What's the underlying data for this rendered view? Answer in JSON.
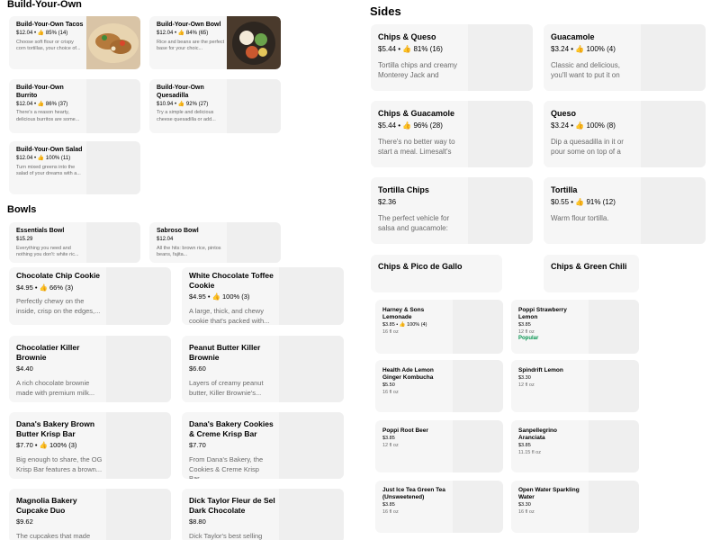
{
  "sections": {
    "build": "Build-Your-Own",
    "sides": "Sides",
    "bowls": "Bowls"
  },
  "build_items": [
    {
      "name": "Build-Your-Own Tacos",
      "meta": "$12.04 • 👍 85% (14)",
      "desc": "Choose soft flour or crispy corn tortillas, your choice of..."
    },
    {
      "name": "Build-Your-Own Bowl",
      "meta": "$12.04 • 👍 84% (65)",
      "desc": "Rice and beans are the perfect base for your choic..."
    },
    {
      "name": "Build-Your-Own Burrito",
      "meta": "$12.04 • 👍 86% (37)",
      "desc": "There's a reason hearty, delicious burritos are some..."
    },
    {
      "name": "Build-Your-Own Quesadilla",
      "meta": "$10.94 • 👍 92% (27)",
      "desc": "Try a simple and delicious cheese quesadilla or add..."
    },
    {
      "name": "Build-Your-Own Salad",
      "meta": "$12.04 • 👍 100% (11)",
      "desc": "Turn mixed greens into the salad of your dreams with a..."
    }
  ],
  "bowl_items": [
    {
      "name": "Essentials Bowl",
      "meta": "$15.29",
      "desc": "Everything you need and nothing you don't: white ric..."
    },
    {
      "name": "Sabroso Bowl",
      "meta": "$12.04",
      "desc": "All the hits: brown rice, pintos beans, fajita..."
    }
  ],
  "dessert_items": [
    {
      "name": "Chocolate Chip Cookie",
      "meta": "$4.95 • 👍 66% (3)",
      "desc": "Perfectly chewy on the inside, crisp on the edges,..."
    },
    {
      "name": "White Chocolate Toffee Cookie",
      "meta": "$4.95 • 👍 100% (3)",
      "desc": "A large, thick, and chewy cookie that's packed with..."
    },
    {
      "name": "Chocolatier Killer Brownie",
      "meta": "$4.40",
      "desc": "A rich chocolate brownie made with premium milk..."
    },
    {
      "name": "Peanut Butter Killer Brownie",
      "meta": "$6.60",
      "desc": "Layers of creamy peanut butter, Killer Brownie's..."
    },
    {
      "name": "Dana's Bakery Brown Butter Krisp Bar",
      "meta": "$7.70 • 👍 100% (3)",
      "desc": "Big enough to share, the OG Krisp Bar features a brown..."
    },
    {
      "name": "Dana's Bakery Cookies & Creme Krisp Bar",
      "meta": "$7.70",
      "desc": "From Dana's Bakery, the Cookies & Creme Krisp Bar..."
    },
    {
      "name": "Magnolia Bakery Cupcake Duo",
      "meta": "$9.62",
      "desc": "The cupcakes that made Magnolia Bakery famous..."
    },
    {
      "name": "Dick Taylor Fleur de Sel Dark Chocolate",
      "meta": "$8.80",
      "desc": "Dick Taylor's best selling Fleur de Sel chocolate is a..."
    }
  ],
  "side_items": [
    {
      "name": "Chips & Queso",
      "meta": "$5.44 • 👍 81% (16)",
      "desc": "Tortilla chips and creamy Monterey Jack and chedda..."
    },
    {
      "name": "Guacamole",
      "meta": "$3.24 • 👍 100% (4)",
      "desc": "Classic and delicious, you'll want to put it on everything..."
    },
    {
      "name": "Chips & Guacamole",
      "meta": "$5.44 • 👍 96% (28)",
      "desc": "There's no better way to start a meal. Limesalt's creamy..."
    },
    {
      "name": "Queso",
      "meta": "$3.24 • 👍 100% (8)",
      "desc": "Dip a quesadilla in it or pour some on top of a burrito, thi..."
    },
    {
      "name": "Tortilla Chips",
      "meta": "$2.36",
      "desc": "The perfect vehicle for salsa and guacamole: crunchy..."
    },
    {
      "name": "Tortilla",
      "meta": "$0.55 • 👍 91% (12)",
      "desc": "Warm flour tortilla."
    },
    {
      "name": "Chips & Pico de Gallo",
      "meta": "",
      "desc": ""
    },
    {
      "name": "Chips & Green Chili",
      "meta": "",
      "desc": ""
    }
  ],
  "drink_items": [
    {
      "name": "Harney & Sons Lemonade",
      "meta": "$3.85 • 👍 100% (4)",
      "size": "16 fl oz",
      "popular": ""
    },
    {
      "name": "Poppi Strawberry Lemon",
      "meta": "$3.85",
      "size": "12 fl oz",
      "popular": "Popular"
    },
    {
      "name": "Health Ade Lemon Ginger Kombucha",
      "meta": "$5.50",
      "size": "16 fl oz",
      "popular": ""
    },
    {
      "name": "Spindrift Lemon",
      "meta": "$3.30",
      "size": "12 fl oz",
      "popular": ""
    },
    {
      "name": "Poppi Root Beer",
      "meta": "$3.85",
      "size": "12 fl oz",
      "popular": ""
    },
    {
      "name": "Sanpellegrino Aranciata",
      "meta": "$3.85",
      "size": "11.15 fl oz",
      "popular": ""
    },
    {
      "name": "Just Ice Tea Green Tea (Unsweetened)",
      "meta": "$3.85",
      "size": "16 fl oz",
      "popular": ""
    },
    {
      "name": "Open Water Sparkling Water",
      "meta": "$3.30",
      "size": "16 fl oz",
      "popular": ""
    }
  ],
  "colors": {
    "card_bg": "#f6f6f6",
    "thumb_bg": "#efefef",
    "muted": "#6b6b6b",
    "popular": "#05944f"
  }
}
